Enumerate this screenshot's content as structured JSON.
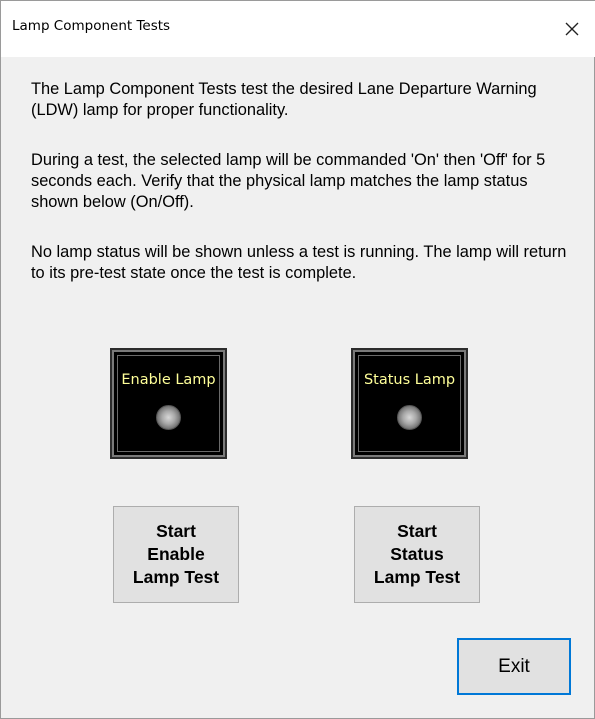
{
  "window": {
    "title": "Lamp Component Tests",
    "close_icon": "close-icon"
  },
  "description": {
    "paragraph1": "The Lamp Component Tests test the desired Lane Departure Warning (LDW) lamp for proper functionality.",
    "paragraph2": "During a test, the selected lamp will be commanded 'On' then 'Off' for 5 seconds each. Verify that the physical lamp matches the lamp status shown below (On/Off).",
    "paragraph3": "No lamp status will be shown unless a test is running.  The lamp will return to its pre-test state once the test is complete."
  },
  "lamps": {
    "enable": {
      "label": "Enable Lamp"
    },
    "status": {
      "label": "Status Lamp"
    }
  },
  "buttons": {
    "start_enable": "Start\nEnable\nLamp Test",
    "start_status": "Start\nStatus\nLamp Test",
    "exit": "Exit"
  },
  "colors": {
    "lamp_label": "#ffff99",
    "lamp_panel": "#000000",
    "exit_focus_border": "#0078d7"
  }
}
